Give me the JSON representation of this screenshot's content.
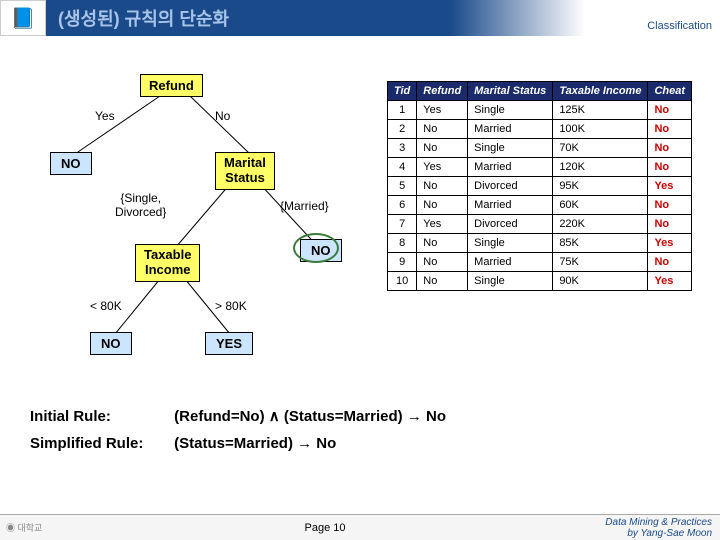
{
  "header": {
    "title": "(생성된) 규칙의 단순화",
    "right": "Classification"
  },
  "tree": {
    "root": "Refund",
    "root_yes": "Yes",
    "root_no": "No",
    "leaf_no1": "NO",
    "marital": "Marital\nStatus",
    "edge_single": "{Single,\nDivorced}",
    "edge_married": "{Married}",
    "taxable": "Taxable\nIncome",
    "leaf_no2": "NO",
    "edge_lt": "< 80K",
    "edge_gt": "> 80K",
    "leaf_no3": "NO",
    "leaf_yes": "YES"
  },
  "table": {
    "headers": [
      "Tid",
      "Refund",
      "Marital Status",
      "Taxable Income",
      "Cheat"
    ],
    "rows": [
      [
        "1",
        "Yes",
        "Single",
        "125K",
        "No"
      ],
      [
        "2",
        "No",
        "Married",
        "100K",
        "No"
      ],
      [
        "3",
        "No",
        "Single",
        "70K",
        "No"
      ],
      [
        "4",
        "Yes",
        "Married",
        "120K",
        "No"
      ],
      [
        "5",
        "No",
        "Divorced",
        "95K",
        "Yes"
      ],
      [
        "6",
        "No",
        "Married",
        "60K",
        "No"
      ],
      [
        "7",
        "Yes",
        "Divorced",
        "220K",
        "No"
      ],
      [
        "8",
        "No",
        "Single",
        "85K",
        "Yes"
      ],
      [
        "9",
        "No",
        "Married",
        "75K",
        "No"
      ],
      [
        "10",
        "No",
        "Single",
        "90K",
        "Yes"
      ]
    ]
  },
  "rules": {
    "initial_label": "Initial Rule:",
    "initial_rule": "(Refund=No) ∧ (Status=Married) → No",
    "simplified_label": "Simplified Rule:",
    "simplified_rule": "(Status=Married) → No"
  },
  "footer": {
    "page": "Page 10",
    "credit1": "Data Mining & Practices",
    "credit2": "by Yang-Sae Moon"
  }
}
